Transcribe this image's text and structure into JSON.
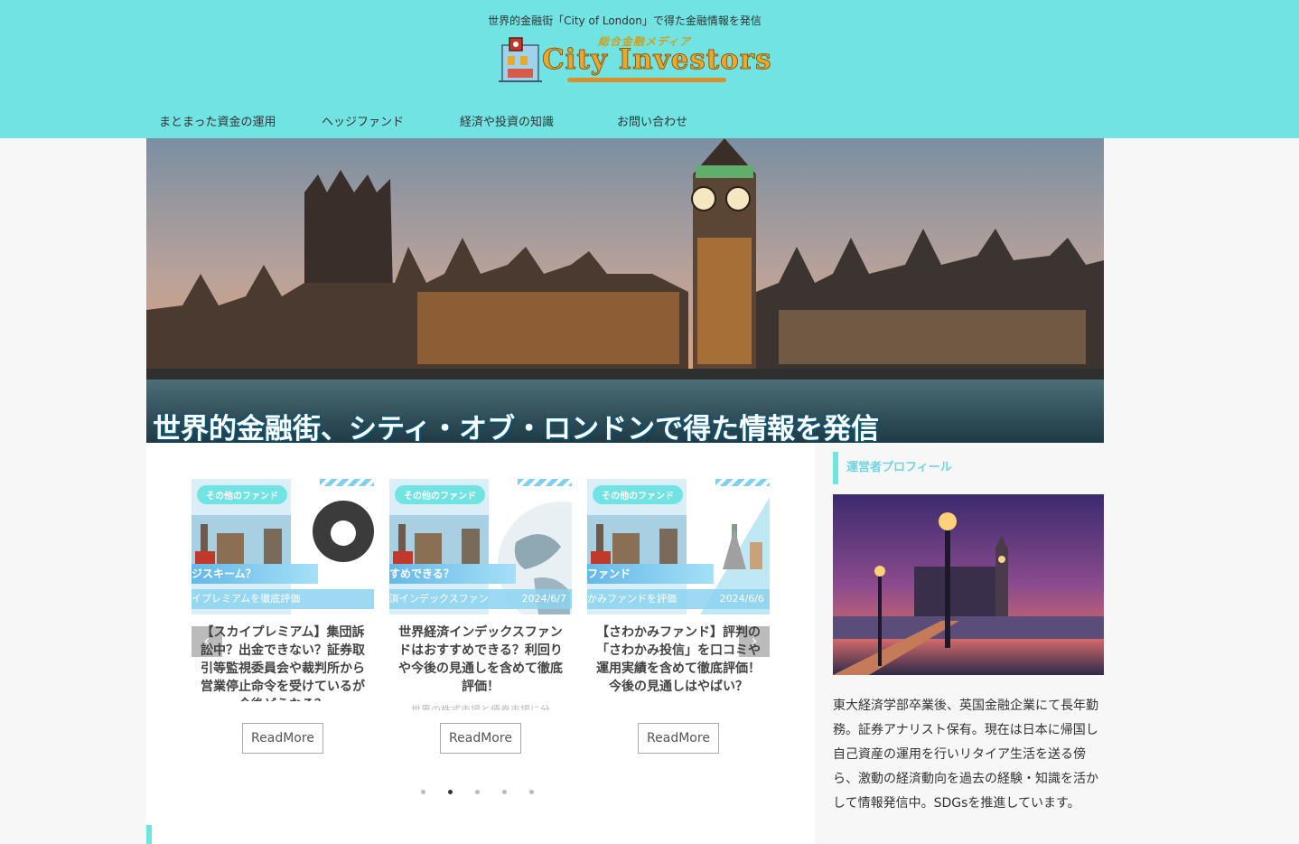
{
  "header": {
    "tagline": "世界的金融街「City of London」で得た金融情報を発信",
    "logo_sub": "総合金融メディア",
    "logo_main": "City Investors"
  },
  "nav": {
    "items": [
      {
        "label": "まとまった資金の運用"
      },
      {
        "label": "ヘッジファンド"
      },
      {
        "label": "経済や投資の知識"
      },
      {
        "label": "お問い合わせ"
      }
    ]
  },
  "hero": {
    "caption": "世界的金融街、シティ・オブ・ロンドンで得た情報を発信"
  },
  "slider": {
    "prev_icon": "chevron-left-icon",
    "next_icon": "chevron-right-icon",
    "cards": [
      {
        "category": "その他のファンド",
        "banner": "ジスキーム？",
        "sub": "イプレミアムを徹底評価",
        "date": "",
        "title": "【スカイプレミアム】集団訴訟中？出金できない？証券取引等監視委員会や裁判所から営業停止命令を受けているが今後どうなる？",
        "excerpt": "",
        "readmore": "ReadMore"
      },
      {
        "category": "その他のファンド",
        "banner": "すめできる？",
        "sub": "済インデックスファン",
        "date": "2024/6/7",
        "title": "世界経済インデックスファンドはおすすめできる？利回りや今後の見通しを含めて徹底評価！",
        "excerpt": "世界の株式市場と債券市場に分",
        "readmore": "ReadMore"
      },
      {
        "category": "その他のファンド",
        "banner": "ファンド",
        "sub": "かみファンドを評価",
        "date": "2024/6/6",
        "title": "【さわかみファンド】評判の「さわかみ投信」を口コミや運用実績を含めて徹底評価！今後の見通しはやばい？",
        "excerpt": "",
        "readmore": "ReadMore"
      }
    ],
    "dots": 5,
    "active_dot": 1
  },
  "sidebar": {
    "heading": "運営者プロフィール",
    "profile": "東大経済学部卒業後、英国金融企業にて長年勤務。証券アナリスト保有。現在は日本に帰国し自己資産の運用を行いリタイア生活を送る傍ら、激動の経済動向を過去の経験・知識を活かして情報発信中。SDGsを推進しています。"
  },
  "colors": {
    "header_bg": "#72e3e3",
    "accent": "#72e3e3",
    "page_bg": "#f7f7f7"
  }
}
